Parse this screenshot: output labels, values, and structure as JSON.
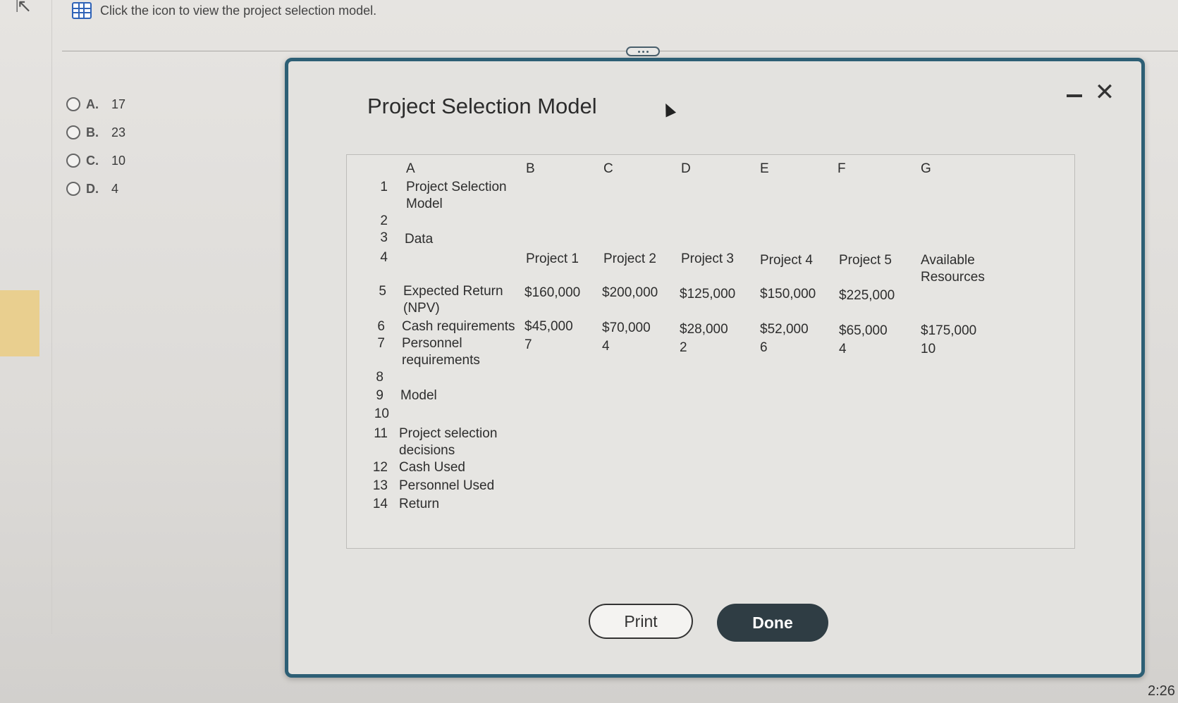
{
  "header": {
    "prompt": "Click the icon to view the project selection model."
  },
  "choices": [
    {
      "letter": "A.",
      "value": "17"
    },
    {
      "letter": "B.",
      "value": "23"
    },
    {
      "letter": "C.",
      "value": "10"
    },
    {
      "letter": "D.",
      "value": "4"
    }
  ],
  "modal": {
    "title": "Project Selection Model",
    "minimize_label": "",
    "close_label": "✕"
  },
  "sheet": {
    "columns": [
      "A",
      "B",
      "C",
      "D",
      "E",
      "F",
      "G"
    ],
    "row_numbers": [
      "1",
      "2",
      "3",
      "4",
      "5",
      "6",
      "7",
      "8",
      "9",
      "10",
      "11",
      "12",
      "13",
      "14"
    ],
    "r1_a": "Project Selection Model",
    "r3_a": "Data",
    "r4": [
      "Project 1",
      "Project 2",
      "Project 3",
      "Project 4",
      "Project 5",
      "Available Resources"
    ],
    "r5_a": "Expected Return (NPV)",
    "r5": [
      "$160,000",
      "$200,000",
      "$125,000",
      "$150,000",
      "$225,000"
    ],
    "r6_a": "Cash requirements",
    "r6": [
      "$45,000",
      "$70,000",
      "$28,000",
      "$52,000",
      "$65,000",
      "$175,000"
    ],
    "r7_a": "Personnel requirements",
    "r7": [
      "7",
      "4",
      "2",
      "6",
      "4",
      "10"
    ],
    "r9_a": "Model",
    "r11_a": "Project selection decisions",
    "r12_a": "Cash Used",
    "r13_a": "Personnel Used",
    "r14_a": "Return"
  },
  "buttons": {
    "print": "Print",
    "done": "Done"
  },
  "clock": "2:26"
}
